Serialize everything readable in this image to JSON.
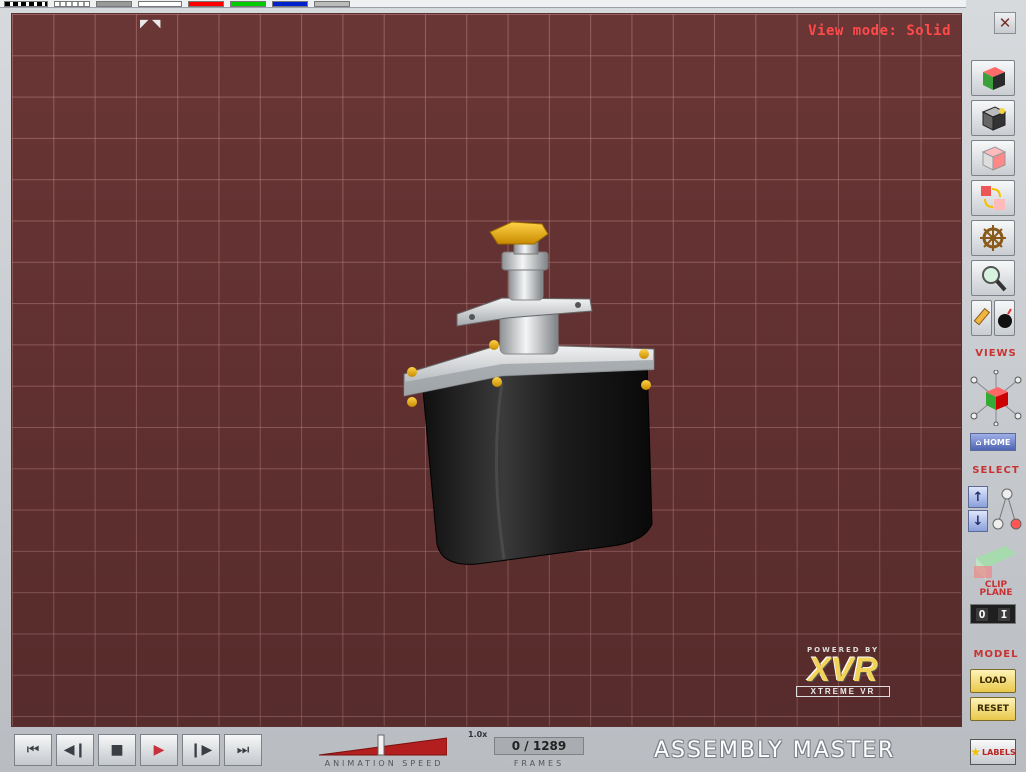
{
  "viewport": {
    "view_mode_text": "View mode: Solid",
    "grid_color": "#6a3535",
    "logo": {
      "powered": "POWERED BY",
      "mark": "XVR",
      "sub": "XTREME VR"
    }
  },
  "top_strip": {
    "swatches": [
      "#000000",
      "#ffffff",
      "#999999",
      "#ffffff",
      "#ff0000",
      "#00cc00",
      "#0022cc",
      "#bbbbbb"
    ]
  },
  "toolbar": {
    "close_label": "✕",
    "sections": {
      "views": "VIEWS",
      "select": "SELECT",
      "clip_plane": "CLIP PLANE",
      "model": "MODEL"
    },
    "home_label": "HOME",
    "select_up": "↑",
    "select_down": "↓",
    "toggle_off": "O",
    "toggle_on": "I",
    "load_label": "LOAD",
    "reset_label": "RESET",
    "labels_label": "LABELS"
  },
  "bottom": {
    "speed_value": "1.0x",
    "speed_label": "ANIMATION SPEED",
    "speed_level": 0.48,
    "frames_value": "0 / 1289",
    "frames_label": "FRAMES",
    "brand": "ASSEMBLY  MASTER",
    "play_color": "#c8303a"
  }
}
